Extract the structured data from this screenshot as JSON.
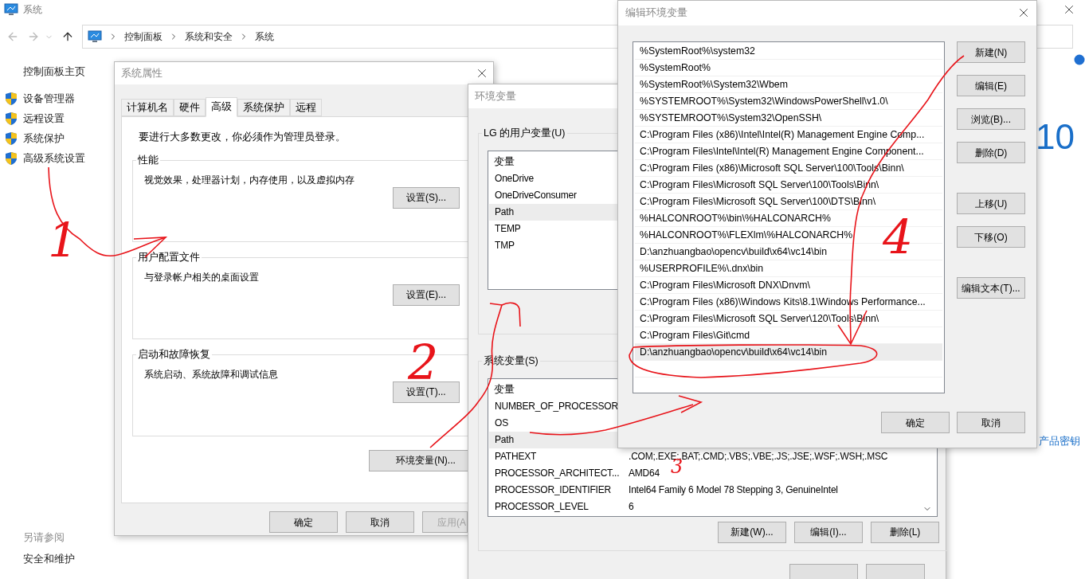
{
  "main_window": {
    "title": "系统",
    "breadcrumb": [
      "控制面板",
      "系统和安全",
      "系统"
    ],
    "sidebar": {
      "home": "控制面板主页",
      "items": [
        {
          "label": "设备管理器"
        },
        {
          "label": "远程设置"
        },
        {
          "label": "系统保护"
        },
        {
          "label": "高级系统设置"
        }
      ],
      "see_also": "另请参阅",
      "see_also_links": [
        "安全和维护"
      ]
    },
    "edition": "10",
    "product_key_link": "产品密钥"
  },
  "system_properties": {
    "title": "系统属性",
    "tabs": [
      {
        "label": "计算机名",
        "selected": false
      },
      {
        "label": "硬件",
        "selected": false
      },
      {
        "label": "高级",
        "selected": true
      },
      {
        "label": "系统保护",
        "selected": false
      },
      {
        "label": "远程",
        "selected": false
      }
    ],
    "admin_note": "要进行大多数更改，你必须作为管理员登录。",
    "groups": [
      {
        "title": "性能",
        "description": "视觉效果，处理器计划，内存使用，以及虚拟内存",
        "button": "设置(S)..."
      },
      {
        "title": "用户配置文件",
        "description": "与登录帐户相关的桌面设置",
        "button": "设置(E)..."
      },
      {
        "title": "启动和故障恢复",
        "description": "系统启动、系统故障和调试信息",
        "button": "设置(T)..."
      }
    ],
    "env_button": "环境变量(N)...",
    "buttons": [
      {
        "label": "确定",
        "disabled": false
      },
      {
        "label": "取消",
        "disabled": false
      },
      {
        "label": "应用(A",
        "disabled": true
      }
    ]
  },
  "environment_variables": {
    "title": "环境变量",
    "user_group": {
      "title": "LG 的用户变量(U)",
      "column": "变量",
      "rows": [
        {
          "name": "OneDrive",
          "selected": false
        },
        {
          "name": "OneDriveConsumer",
          "selected": false
        },
        {
          "name": "Path",
          "selected": true
        },
        {
          "name": "TEMP",
          "selected": false
        },
        {
          "name": "TMP",
          "selected": false
        }
      ]
    },
    "system_group": {
      "title": "系统变量(S)",
      "column": "变量",
      "rows": [
        {
          "name": "NUMBER_OF_PROCESSOR",
          "selected": false
        },
        {
          "name": "OS",
          "selected": false
        },
        {
          "name": "Path",
          "selected": true
        },
        {
          "name": "PATHEXT",
          "value": ".COM;.EXE;.BAT;.CMD;.VBS;.VBE;.JS;.JSE;.WSF;.WSH;.MSC",
          "selected": false
        },
        {
          "name": "PROCESSOR_ARCHITECT...",
          "value": "AMD64",
          "selected": false
        },
        {
          "name": "PROCESSOR_IDENTIFIER",
          "value": "Intel64 Family 6 Model 78 Stepping 3, GenuineIntel",
          "selected": false
        },
        {
          "name": "PROCESSOR_LEVEL",
          "value": "6",
          "selected": false
        }
      ]
    },
    "buttons": [
      "新建(W)...",
      "编辑(I)...",
      "删除(L)"
    ]
  },
  "edit_variable": {
    "title": "编辑环境变量",
    "entries": [
      {
        "text": "%SystemRoot%\\system32",
        "selected": false
      },
      {
        "text": "%SystemRoot%",
        "selected": false
      },
      {
        "text": "%SystemRoot%\\System32\\Wbem",
        "selected": false
      },
      {
        "text": "%SYSTEMROOT%\\System32\\WindowsPowerShell\\v1.0\\",
        "selected": false
      },
      {
        "text": "%SYSTEMROOT%\\System32\\OpenSSH\\",
        "selected": false
      },
      {
        "text": "C:\\Program Files (x86)\\Intel\\Intel(R) Management Engine Comp...",
        "selected": false
      },
      {
        "text": "C:\\Program Files\\Intel\\Intel(R) Management Engine Component...",
        "selected": false
      },
      {
        "text": "C:\\Program Files (x86)\\Microsoft SQL Server\\100\\Tools\\Binn\\",
        "selected": false
      },
      {
        "text": "C:\\Program Files\\Microsoft SQL Server\\100\\Tools\\Binn\\",
        "selected": false
      },
      {
        "text": "C:\\Program Files\\Microsoft SQL Server\\100\\DTS\\Binn\\",
        "selected": false
      },
      {
        "text": "%HALCONROOT%\\bin\\%HALCONARCH%",
        "selected": false
      },
      {
        "text": "%HALCONROOT%\\FLEXlm\\%HALCONARCH%",
        "selected": false
      },
      {
        "text": "D:\\anzhuangbao\\opencv\\build\\x64\\vc14\\bin",
        "selected": false
      },
      {
        "text": "%USERPROFILE%\\.dnx\\bin",
        "selected": false
      },
      {
        "text": "C:\\Program Files\\Microsoft DNX\\Dnvm\\",
        "selected": false
      },
      {
        "text": "C:\\Program Files (x86)\\Windows Kits\\8.1\\Windows Performance...",
        "selected": false
      },
      {
        "text": "C:\\Program Files\\Microsoft SQL Server\\120\\Tools\\Binn\\",
        "selected": false
      },
      {
        "text": "C:\\Program Files\\Git\\cmd",
        "selected": false
      },
      {
        "text": "D:\\anzhuangbao\\opencv\\build\\x64\\vc14\\bin",
        "selected": true
      }
    ],
    "side_button_groups": [
      [
        "新建(N)",
        "编辑(E)",
        "浏览(B)...",
        "删除(D)"
      ],
      [
        "上移(U)",
        "下移(O)"
      ],
      [
        "编辑文本(T)..."
      ]
    ],
    "buttons": [
      "确定",
      "取消"
    ]
  },
  "annotations": [
    {
      "text": "1"
    },
    {
      "text": "2"
    },
    {
      "text": "3"
    },
    {
      "text": "4"
    }
  ]
}
